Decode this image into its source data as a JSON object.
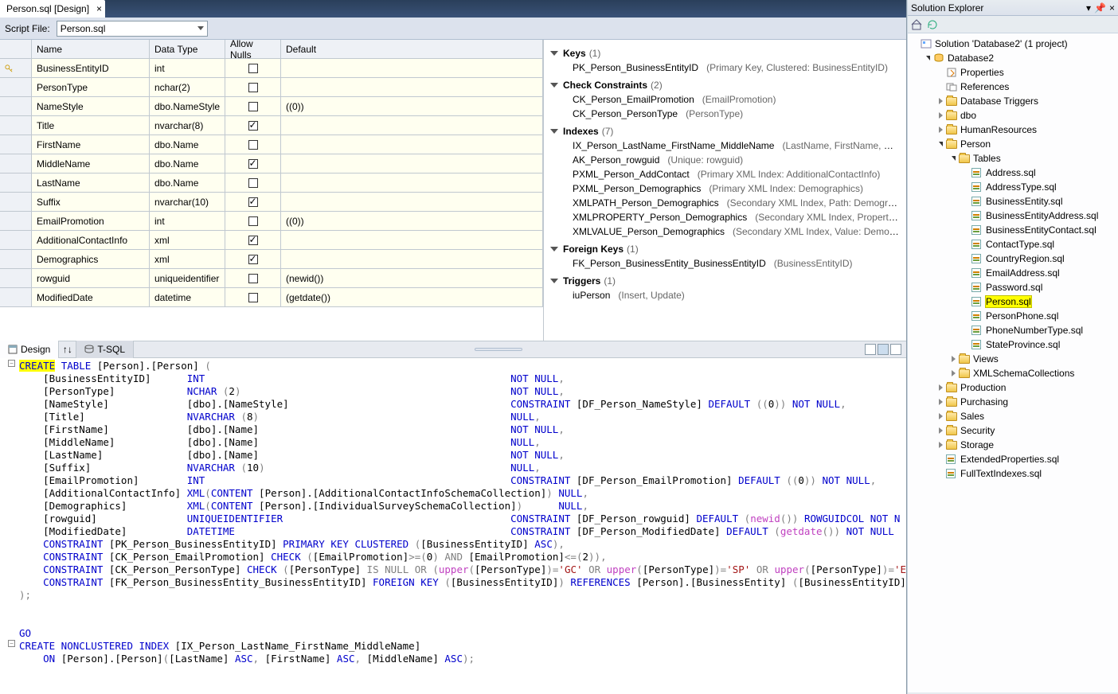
{
  "tab": {
    "title": "Person.sql [Design]"
  },
  "scriptFile": {
    "label": "Script File:",
    "value": "Person.sql"
  },
  "grid": {
    "headers": {
      "name": "Name",
      "type": "Data Type",
      "nulls": "Allow Nulls",
      "default": "Default"
    },
    "rows": [
      {
        "key": true,
        "name": "BusinessEntityID",
        "type": "int",
        "nulls": false,
        "default": ""
      },
      {
        "key": false,
        "name": "PersonType",
        "type": "nchar(2)",
        "nulls": false,
        "default": ""
      },
      {
        "key": false,
        "name": "NameStyle",
        "type": "dbo.NameStyle",
        "nulls": false,
        "default": "((0))"
      },
      {
        "key": false,
        "name": "Title",
        "type": "nvarchar(8)",
        "nulls": true,
        "default": ""
      },
      {
        "key": false,
        "name": "FirstName",
        "type": "dbo.Name",
        "nulls": false,
        "default": ""
      },
      {
        "key": false,
        "name": "MiddleName",
        "type": "dbo.Name",
        "nulls": true,
        "default": ""
      },
      {
        "key": false,
        "name": "LastName",
        "type": "dbo.Name",
        "nulls": false,
        "default": ""
      },
      {
        "key": false,
        "name": "Suffix",
        "type": "nvarchar(10)",
        "nulls": true,
        "default": ""
      },
      {
        "key": false,
        "name": "EmailPromotion",
        "type": "int",
        "nulls": false,
        "default": "((0))"
      },
      {
        "key": false,
        "name": "AdditionalContactInfo",
        "type": "xml",
        "nulls": true,
        "default": ""
      },
      {
        "key": false,
        "name": "Demographics",
        "type": "xml",
        "nulls": true,
        "default": ""
      },
      {
        "key": false,
        "name": "rowguid",
        "type": "uniqueidentifier",
        "nulls": false,
        "default": "(newid())"
      },
      {
        "key": false,
        "name": "ModifiedDate",
        "type": "datetime",
        "nulls": false,
        "default": "(getdate())"
      }
    ]
  },
  "props": {
    "keys": {
      "label": "Keys",
      "count": "(1)",
      "items": [
        {
          "name": "PK_Person_BusinessEntityID",
          "detail": "(Primary Key, Clustered: BusinessEntityID)"
        }
      ]
    },
    "checks": {
      "label": "Check Constraints",
      "count": "(2)",
      "items": [
        {
          "name": "CK_Person_EmailPromotion",
          "detail": "(EmailPromotion)"
        },
        {
          "name": "CK_Person_PersonType",
          "detail": "(PersonType)"
        }
      ]
    },
    "indexes": {
      "label": "Indexes",
      "count": "(7)",
      "items": [
        {
          "name": "IX_Person_LastName_FirstName_MiddleName",
          "detail": "(LastName, FirstName, Middl"
        },
        {
          "name": "AK_Person_rowguid",
          "detail": "(Unique: rowguid)"
        },
        {
          "name": "PXML_Person_AddContact",
          "detail": "(Primary XML Index: AdditionalContactInfo)"
        },
        {
          "name": "PXML_Person_Demographics",
          "detail": "(Primary XML Index: Demographics)"
        },
        {
          "name": "XMLPATH_Person_Demographics",
          "detail": "(Secondary XML Index, Path: Demographi"
        },
        {
          "name": "XMLPROPERTY_Person_Demographics",
          "detail": "(Secondary XML Index, Property: Der"
        },
        {
          "name": "XMLVALUE_Person_Demographics",
          "detail": "(Secondary XML Index, Value: Demograp"
        }
      ]
    },
    "fks": {
      "label": "Foreign Keys",
      "count": "(1)",
      "items": [
        {
          "name": "FK_Person_BusinessEntity_BusinessEntityID",
          "detail": "(BusinessEntityID)"
        }
      ]
    },
    "triggers": {
      "label": "Triggers",
      "count": "(1)",
      "items": [
        {
          "name": "iuPerson",
          "detail": "(Insert, Update)"
        }
      ]
    }
  },
  "viewTabs": {
    "design": "Design",
    "tsql": "T-SQL"
  },
  "solutionExplorer": {
    "title": "Solution Explorer",
    "solution": "Solution 'Database2' (1 project)",
    "project": "Database2",
    "properties": "Properties",
    "references": "References",
    "topFolders": [
      {
        "name": "Database Triggers"
      },
      {
        "name": "dbo"
      },
      {
        "name": "HumanResources"
      }
    ],
    "person": "Person",
    "tables": "Tables",
    "tableFiles": [
      "Address.sql",
      "AddressType.sql",
      "BusinessEntity.sql",
      "BusinessEntityAddress.sql",
      "BusinessEntityContact.sql",
      "ContactType.sql",
      "CountryRegion.sql",
      "EmailAddress.sql",
      "Password.sql",
      "Person.sql",
      "PersonPhone.sql",
      "PhoneNumberType.sql",
      "StateProvince.sql"
    ],
    "personSub": [
      "Views",
      "XMLSchemaCollections"
    ],
    "otherFolders": [
      "Production",
      "Purchasing",
      "Sales",
      "Security",
      "Storage"
    ],
    "rootFiles": [
      "ExtendedProperties.sql",
      "FullTextIndexes.sql"
    ],
    "selectedFile": "Person.sql"
  }
}
